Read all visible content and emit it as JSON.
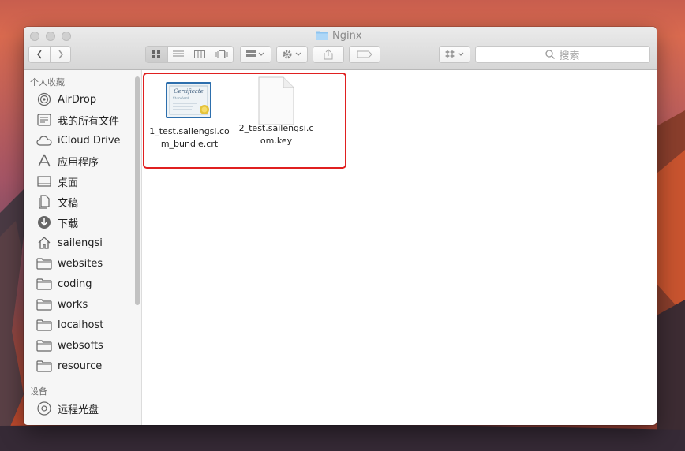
{
  "window": {
    "title": "Nginx"
  },
  "toolbar": {
    "search_placeholder": "搜索",
    "colors": {
      "toolbar_bg": "#e3e3e3",
      "icon": "#8a8a8a"
    }
  },
  "sidebar": {
    "favorites_title": "个人收藏",
    "devices_title": "设备",
    "items": [
      {
        "label": "AirDrop",
        "icon": "airdrop-icon"
      },
      {
        "label": "我的所有文件",
        "icon": "all-files-icon"
      },
      {
        "label": "iCloud Drive",
        "icon": "cloud-icon"
      },
      {
        "label": "应用程序",
        "icon": "applications-icon"
      },
      {
        "label": "桌面",
        "icon": "desktop-icon"
      },
      {
        "label": "文稿",
        "icon": "documents-icon"
      },
      {
        "label": "下载",
        "icon": "download-icon"
      },
      {
        "label": "sailengsi",
        "icon": "home-icon"
      },
      {
        "label": "websites",
        "icon": "folder-icon"
      },
      {
        "label": "coding",
        "icon": "folder-icon"
      },
      {
        "label": "works",
        "icon": "folder-icon"
      },
      {
        "label": "localhost",
        "icon": "folder-icon"
      },
      {
        "label": "websofts",
        "icon": "folder-icon"
      },
      {
        "label": "resource",
        "icon": "folder-icon"
      }
    ],
    "devices": [
      {
        "label": "远程光盘",
        "icon": "disc-icon"
      }
    ]
  },
  "files": [
    {
      "name_line1": "1_test.sailengsi.co",
      "name_line2": "m_bundle.crt",
      "icon": "certificate-icon"
    },
    {
      "name_line1": "2_test.sailengsi.c",
      "name_line2": "om.key",
      "icon": "document-icon"
    }
  ],
  "annotation": {
    "highlight_color": "#e02020"
  }
}
